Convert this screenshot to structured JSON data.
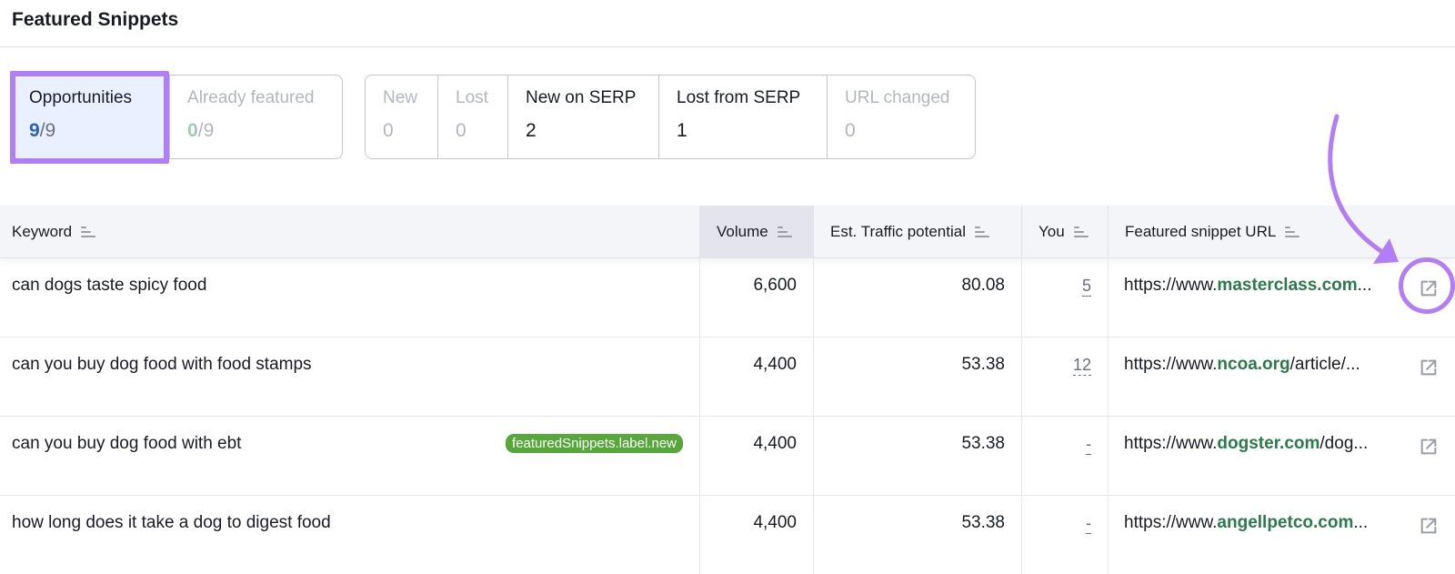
{
  "header": {
    "title": "Featured Snippets"
  },
  "filters": {
    "group1": [
      {
        "label": "Opportunities",
        "count": "9",
        "total": "/9",
        "active": true,
        "disabled": false
      },
      {
        "label": "Already featured",
        "count": "0",
        "total": "/9",
        "active": false,
        "disabled": true
      }
    ],
    "group2": [
      {
        "label": "New",
        "value": "0",
        "disabled": true
      },
      {
        "label": "Lost",
        "value": "0",
        "disabled": true
      },
      {
        "label": "New on SERP",
        "value": "2",
        "disabled": false
      },
      {
        "label": "Lost from SERP",
        "value": "1",
        "disabled": false
      },
      {
        "label": "URL changed",
        "value": "0",
        "disabled": true
      }
    ]
  },
  "table": {
    "columns": {
      "keyword": "Keyword",
      "volume": "Volume",
      "traffic": "Est. Traffic potential",
      "you": "You",
      "url": "Featured snippet URL"
    },
    "rows": [
      {
        "keyword": "can dogs taste spicy food",
        "badge": "",
        "volume": "6,600",
        "traffic": "80.08",
        "you": "5",
        "url_prefix": "https://www.",
        "url_domain": "masterclass.com",
        "url_suffix": "..."
      },
      {
        "keyword": "can you buy dog food with food stamps",
        "badge": "",
        "volume": "4,400",
        "traffic": "53.38",
        "you": "12",
        "url_prefix": "https://www.",
        "url_domain": "ncoa.org",
        "url_suffix": "/article/..."
      },
      {
        "keyword": "can you buy dog food with ebt",
        "badge": "featuredSnippets.label.new",
        "volume": "4,400",
        "traffic": "53.38",
        "you": "-",
        "url_prefix": "https://www.",
        "url_domain": "dogster.com",
        "url_suffix": "/dog..."
      },
      {
        "keyword": "how long does it take a dog to digest food",
        "badge": "",
        "volume": "4,400",
        "traffic": "53.38",
        "you": "-",
        "url_prefix": "https://www.",
        "url_domain": "angellpetco.com",
        "url_suffix": "..."
      }
    ]
  },
  "colors": {
    "accent": "#b27ef5",
    "link_green": "#2a7a4b",
    "badge_green": "#56a83a",
    "active_tab": "#e9f0ff"
  },
  "icons": {
    "sort": "sort-lines-icon",
    "external": "external-link-icon"
  }
}
